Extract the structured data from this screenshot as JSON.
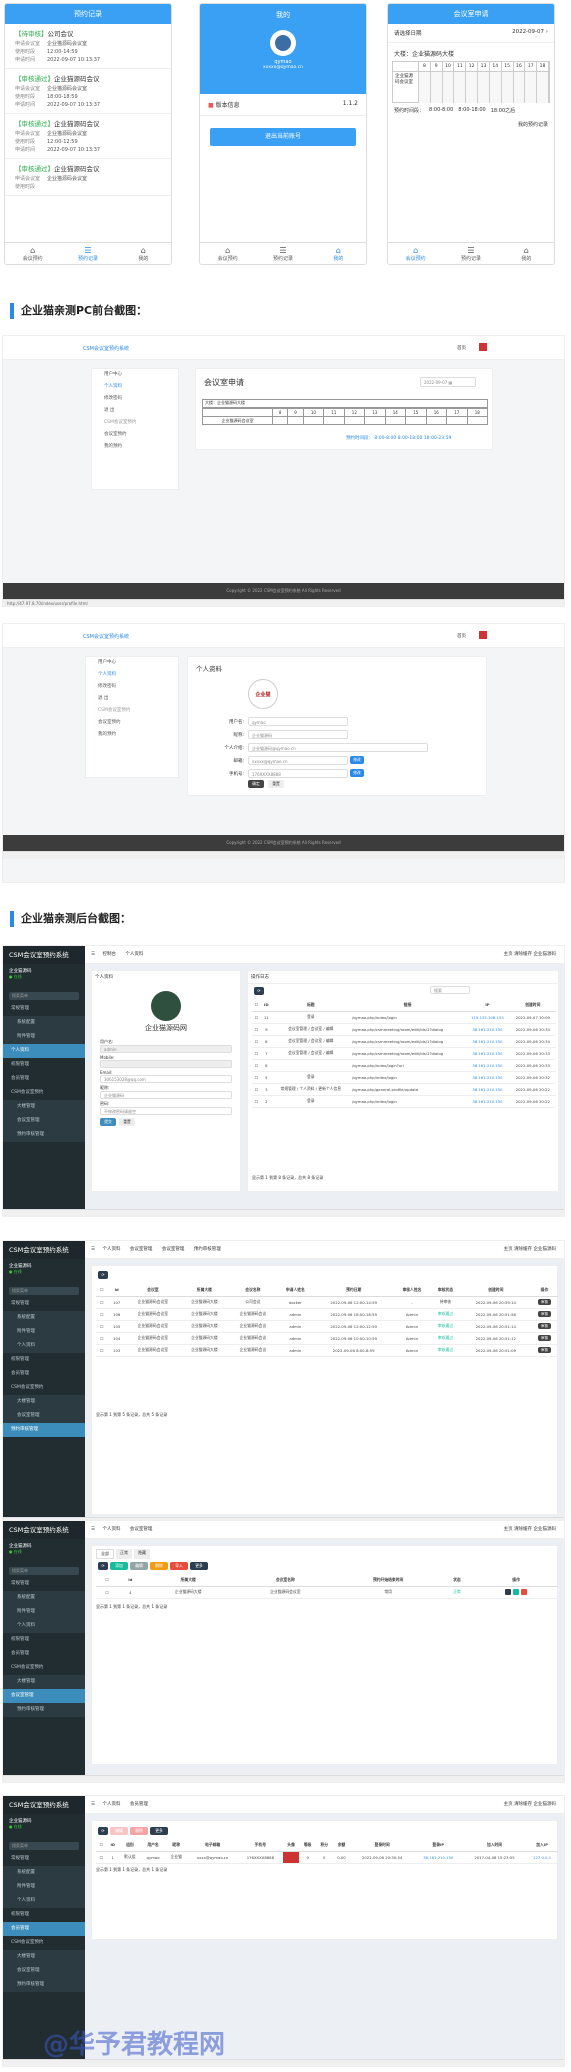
{
  "phone1": {
    "title": "预约记录",
    "records": [
      {
        "status": "【待审核】",
        "room": "公司会议",
        "f1": "申请会议室",
        "v1": "企业猫源码会议室",
        "f2": "使用时段",
        "v2": "12:00-14:59",
        "f3": "申请时间",
        "v3": "2022-09-07 10:13:37"
      },
      {
        "status": "【审核通过】",
        "room": "企业猫源码会议",
        "f1": "申请会议室",
        "v1": "企业猫源码会议室",
        "f2": "使用时段",
        "v2": "18:00-18:59",
        "f3": "申请时间",
        "v3": "2022-09-07 10:13:37"
      },
      {
        "status": "【审核通过】",
        "room": "企业猫源码会议",
        "f1": "申请会议室",
        "v1": "企业猫源码会议室",
        "f2": "使用时段",
        "v2": "12:00-12:59",
        "f3": "申请时间",
        "v3": "2022-09-07 10:13:37"
      },
      {
        "status": "【审核通过】",
        "room": "企业猫源码会议",
        "f1": "申请会议室",
        "v1": "企业猫源码会议室",
        "f2": "使用时段",
        "v2": "",
        "f3": "",
        "v3": ""
      }
    ],
    "tabs": [
      "会议预约",
      "预约记录",
      "我的"
    ]
  },
  "phone2": {
    "title": "我的",
    "user": "qymao",
    "email": "xxxxx@qymao.cn",
    "version_label": "版本信息",
    "version": "1.1.2",
    "logout": "退出当前账号",
    "tabs": [
      "会议预约",
      "预约记录",
      "我的"
    ]
  },
  "phone3": {
    "title": "会议室申请",
    "date_label": "请选择日期",
    "date": "2022-09-07",
    "building": "大楼：企业猫源码大楼",
    "hours": [
      "8",
      "9",
      "10",
      "11",
      "12",
      "13",
      "14",
      "15",
      "16",
      "17",
      "18"
    ],
    "room": "企业猫源码会议室",
    "booked_label": "预约时间段：",
    "booked": [
      "8:00-8:00",
      "8:00-18:00",
      "18:00之后"
    ],
    "my": "我的预约记录",
    "tabs": [
      "会议预约",
      "预约记录",
      "我的"
    ]
  },
  "sec1": "企业猫亲测PC前台截图：",
  "sec2": "企业猫亲测后台截图：",
  "pc1": {
    "logo": "CSM会议室预约系统",
    "nav_home": "首页",
    "menu": [
      "用户中心",
      "个人资料",
      "修改密码",
      "退 出",
      "CSM会议室预约",
      "会议室预约",
      "我的预约"
    ],
    "title": "会议室申请",
    "date": "2022-09-07",
    "building": "大楼：企业猫源码大楼",
    "hours": [
      "8",
      "9",
      "10",
      "11",
      "12",
      "13",
      "14",
      "15",
      "16",
      "17",
      "18"
    ],
    "room": "企业猫源码会议室",
    "booked": "预约时间段：  8:00-8:00  8:00-18:00  18:00-23:59",
    "copyright": "Copyright © 2022 CSM会议室预约系统 All Rights Reserved",
    "url": "http://47.97.8.70/index/user/profile.html"
  },
  "pc2": {
    "logo": "CSM会议室预约系统",
    "nav_home": "首页",
    "title": "个人资料",
    "stamp": "企业猫",
    "fields": [
      {
        "k": "用户名:",
        "v": "qymao"
      },
      {
        "k": "昵称:",
        "v": "企业猫源码"
      },
      {
        "k": "个人介绍:",
        "v": "企业猫源码@qymao.cn"
      },
      {
        "k": "邮箱:",
        "v": "xxxxx@qymao.cn"
      },
      {
        "k": "手机号:",
        "v": "176XXXX8888"
      }
    ],
    "change": "修改",
    "submit": "确定",
    "reset": "重置",
    "menu": [
      "用户中心",
      "个人资料",
      "修改密码",
      "退 出",
      "CSM会议室预约",
      "会议室预约",
      "我的预约"
    ],
    "copyright": "Copyright © 2022 CSM会议室预约系统 All Rights Reserved"
  },
  "adm": {
    "brand": "CSM会议室预约系统",
    "user": "企业猫源码",
    "online": "在线",
    "search": "搜索菜单",
    "menus": [
      "常规管理",
      "系统配置",
      "附件管理",
      "个人资料",
      "权限管理",
      "会员管理",
      "CSM会议室预约",
      "大楼管理",
      "会议室管理",
      "预约审核管理"
    ],
    "top_right": [
      "主页",
      "清除缓存",
      "企业猫源码"
    ]
  },
  "adm1": {
    "tabs": [
      "控制台",
      "个人资料"
    ],
    "profile_title": "个人资料",
    "company": "企业猫源码网",
    "labels": [
      "用户名:",
      "Mobile:",
      "Email:",
      "昵称:",
      "密码:"
    ],
    "values": [
      "admin",
      "",
      "306153028@qq.com",
      "企业猫源码",
      ""
    ],
    "pwd_ph": "不修改密码请留空",
    "submit": "提交",
    "reset": "重置",
    "log_title": "操作日志",
    "search": "搜索",
    "cols": [
      "ID",
      "标题",
      "链接",
      "IP",
      "创建时间"
    ],
    "rows": [
      [
        "11",
        "登录",
        "/qymao.php/index/login",
        "119.135.108.155",
        "2022-09-07 10:09"
      ],
      [
        "9",
        "会议室管理 / 会议室 / 编辑",
        "/qymao.php/csmmeeting/room/edit/ids/1?dialog",
        "36.161.210.150",
        "2022-09-06 20:34"
      ],
      [
        "8",
        "会议室管理 / 会议室 / 编辑",
        "/qymao.php/csmmeeting/room/edit/ids/1?dialog",
        "36.161.210.150",
        "2022-09-06 20:34"
      ],
      [
        "7",
        "会议室管理 / 会议室 / 编辑",
        "/qymao.php/csmmeeting/room/edit/ids/1?dialog",
        "36.161.210.150",
        "2022-09-06 20:33"
      ],
      [
        "6",
        "",
        "/qymao.php/index/login?url",
        "36.161.210.150",
        "2022-09-06 20:33"
      ],
      [
        "5",
        "登录",
        "/qymao.php/index/login",
        "36.161.210.150",
        "2022-09-06 20:32"
      ],
      [
        "3",
        "常规管理 / 个人资料 / 更新个人信息",
        "/qymao.php/general.profile/update",
        "36.161.210.150",
        "2022-09-06 20:22"
      ],
      [
        "2",
        "登录",
        "/qymao.php/index/login",
        "36.161.210.150",
        "2022-09-06 20:22"
      ]
    ],
    "footer": "显示第 1 到第 8 条记录，总共 8 条记录"
  },
  "adm2": {
    "tabs": [
      "个人资料",
      "会议室管理",
      "会议室管理",
      "预约审核管理"
    ],
    "cols": [
      "Id",
      "会议室",
      "所属大楼",
      "会议名称",
      "申请人姓名",
      "预约日期",
      "审核人姓名",
      "审核状态",
      "创建时间",
      "操作"
    ],
    "rows": [
      [
        "107",
        "企业猫源码会议室",
        "企业猫源码大楼",
        "公司会议",
        "docker",
        "2022-09-06 12:00-14:59",
        "-",
        "待审核",
        "2022-09-06 20:59:14"
      ],
      [
        "106",
        "企业猫源码会议室",
        "企业猫源码大楼",
        "企业猫源码会议",
        "admin",
        "2022-09-06 18:00-18:59",
        "Admin",
        "审核通过",
        "2022-09-06 20:51:56"
      ],
      [
        "105",
        "企业猫源码会议室",
        "企业猫源码大楼",
        "企业猫源码会议",
        "admin",
        "2022-09-06 12:00-12:59",
        "Admin",
        "审核通过",
        "2022-09-06 20:51:14"
      ],
      [
        "104",
        "企业猫源码会议室",
        "企业猫源码大楼",
        "企业猫源码会议",
        "admin",
        "2022-09-06 10:00-10:59",
        "Admin",
        "审核通过",
        "2022-09-06 20:51:12"
      ],
      [
        "103",
        "企业猫源码会议室",
        "企业猫源码大楼",
        "企业猫源码会议",
        "admin",
        "2022-09-06 8:00-8:59",
        "Admin",
        "审核通过",
        "2022-09-06 20:51:09"
      ]
    ],
    "op": "审核",
    "footer": "显示第 1 到第 5 条记录，总共 5 条记录"
  },
  "adm3": {
    "tabs": [
      "个人资料",
      "会议室管理"
    ],
    "subtabs": [
      "全部",
      "正常",
      "隐藏"
    ],
    "btns": [
      "添加",
      "编辑",
      "删除",
      "导入",
      "更多"
    ],
    "cols": [
      "Id",
      "所属大楼",
      "会议室名称",
      "预约开始结束时间",
      "状态",
      "操作"
    ],
    "row": [
      "4",
      "企业猫源码大楼",
      "企业猫源码会议室",
      "常用",
      "正常"
    ],
    "footer": "显示第 1 到第 1 条记录，总共 1 条记录"
  },
  "adm4": {
    "tabs": [
      "个人资料",
      "会员管理"
    ],
    "btns": [
      "编辑",
      "删除",
      "更多"
    ],
    "cols": [
      "ID",
      "组别",
      "用户名",
      "昵称",
      "电子邮箱",
      "手机号",
      "头像",
      "等级",
      "积分",
      "余额",
      "登录时间",
      "登录IP",
      "加入时间",
      "加入IP"
    ],
    "row": [
      "1",
      "默认组",
      "qymao",
      "企业猫",
      "xxxx@qymao.cn",
      "176XXXX8888",
      "",
      "0",
      "0",
      "0.00",
      "2022-09-06 20:30:54",
      "36.161.210.150",
      "2017-04-08 15:23:55",
      "127.0.0.1"
    ],
    "footer": "显示第 1 到第 1 条记录，总共 1 条记录"
  },
  "watermark": "@华予君教程网",
  "colors": {
    "blue": "#3aa0f3",
    "accent": "#2a8ae6",
    "green": "#2fae4e",
    "admin_side": "#222d32",
    "admin_active": "#3c8dbc"
  }
}
